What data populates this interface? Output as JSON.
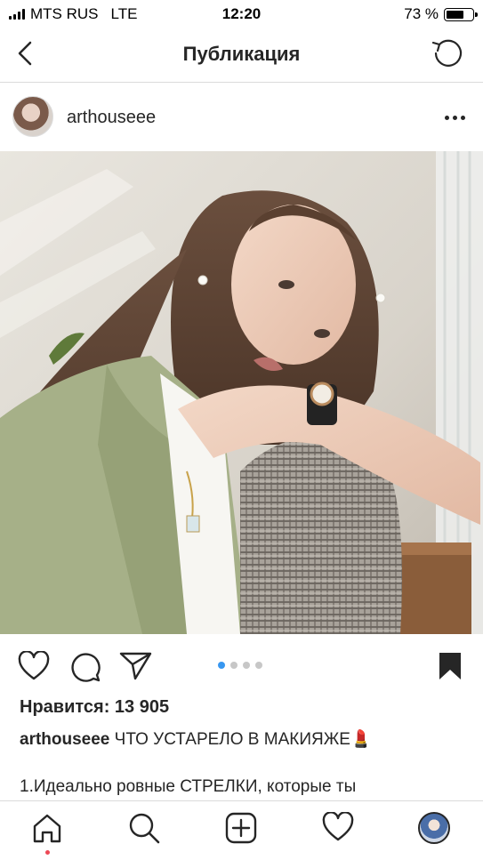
{
  "status_bar": {
    "carrier": "MTS RUS",
    "network": "LTE",
    "time": "12:20",
    "battery": "73 %",
    "battery_level": 0.73
  },
  "header": {
    "title": "Публикация"
  },
  "post": {
    "username": "arthouseee",
    "carousel": {
      "total": 4,
      "active": 0
    },
    "likes_text": "Нравится: 13 905",
    "caption_username": "arthouseee",
    "caption_text": "ЧТО УСТАРЕЛО В МАКИЯЖЕ",
    "caption_emoji": "💄",
    "caption_line2": "1.Идеально ровные СТРЕЛКИ, которые ты"
  },
  "tabbar": {
    "items": [
      "home-icon",
      "search-icon",
      "add-icon",
      "heart-icon",
      "profile-avatar"
    ],
    "active": "home-icon"
  },
  "colors": {
    "text": "#262626",
    "divider": "#dbdbdb",
    "accent_dot": "#3897f0",
    "notification_dot": "#ed4956"
  }
}
